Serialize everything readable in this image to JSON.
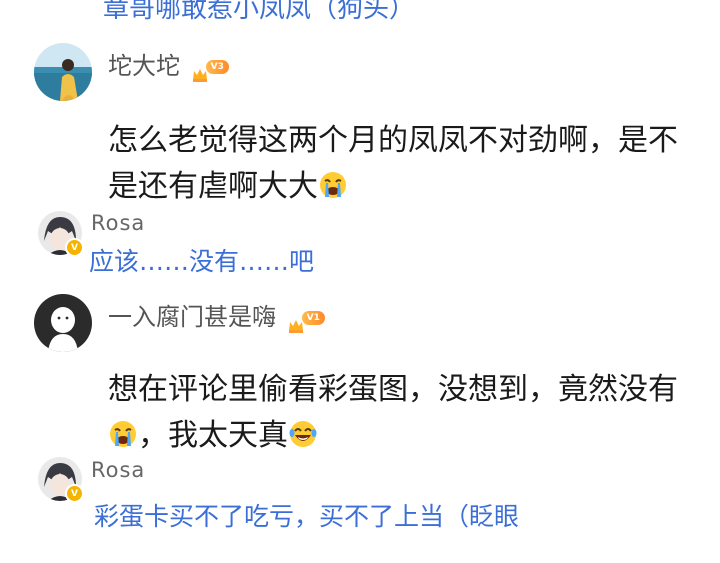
{
  "previous_reply": {
    "text": "章哥哪敢惹小凤凤（狗头）"
  },
  "comments": [
    {
      "username": "坨大坨",
      "level": "V3",
      "text": "怎么老觉得这两个月的凤凤不对劲啊，是不是还有虐啊大大",
      "reply": {
        "username": "Rosa",
        "text": "应该……没有……吧"
      }
    },
    {
      "username": "一入腐门甚是嗨",
      "level": "V1",
      "text_part1": "想在评论里偷看彩蛋图，没想到，竟然没有",
      "text_part2": "，我太天真",
      "reply": {
        "username": "Rosa",
        "text": "彩蛋卡买不了吃亏，买不了上当（眨眼"
      }
    }
  ],
  "icons": {
    "vip_crown": "crown-icon",
    "verified": "v-badge-icon",
    "emoji_cry": "crying-face-icon",
    "emoji_laugh": "laughing-tears-icon"
  },
  "colors": {
    "link_blue": "#3b6fd6",
    "vip_orange": "#ff9a2e",
    "verified_yellow": "#f5b400"
  }
}
